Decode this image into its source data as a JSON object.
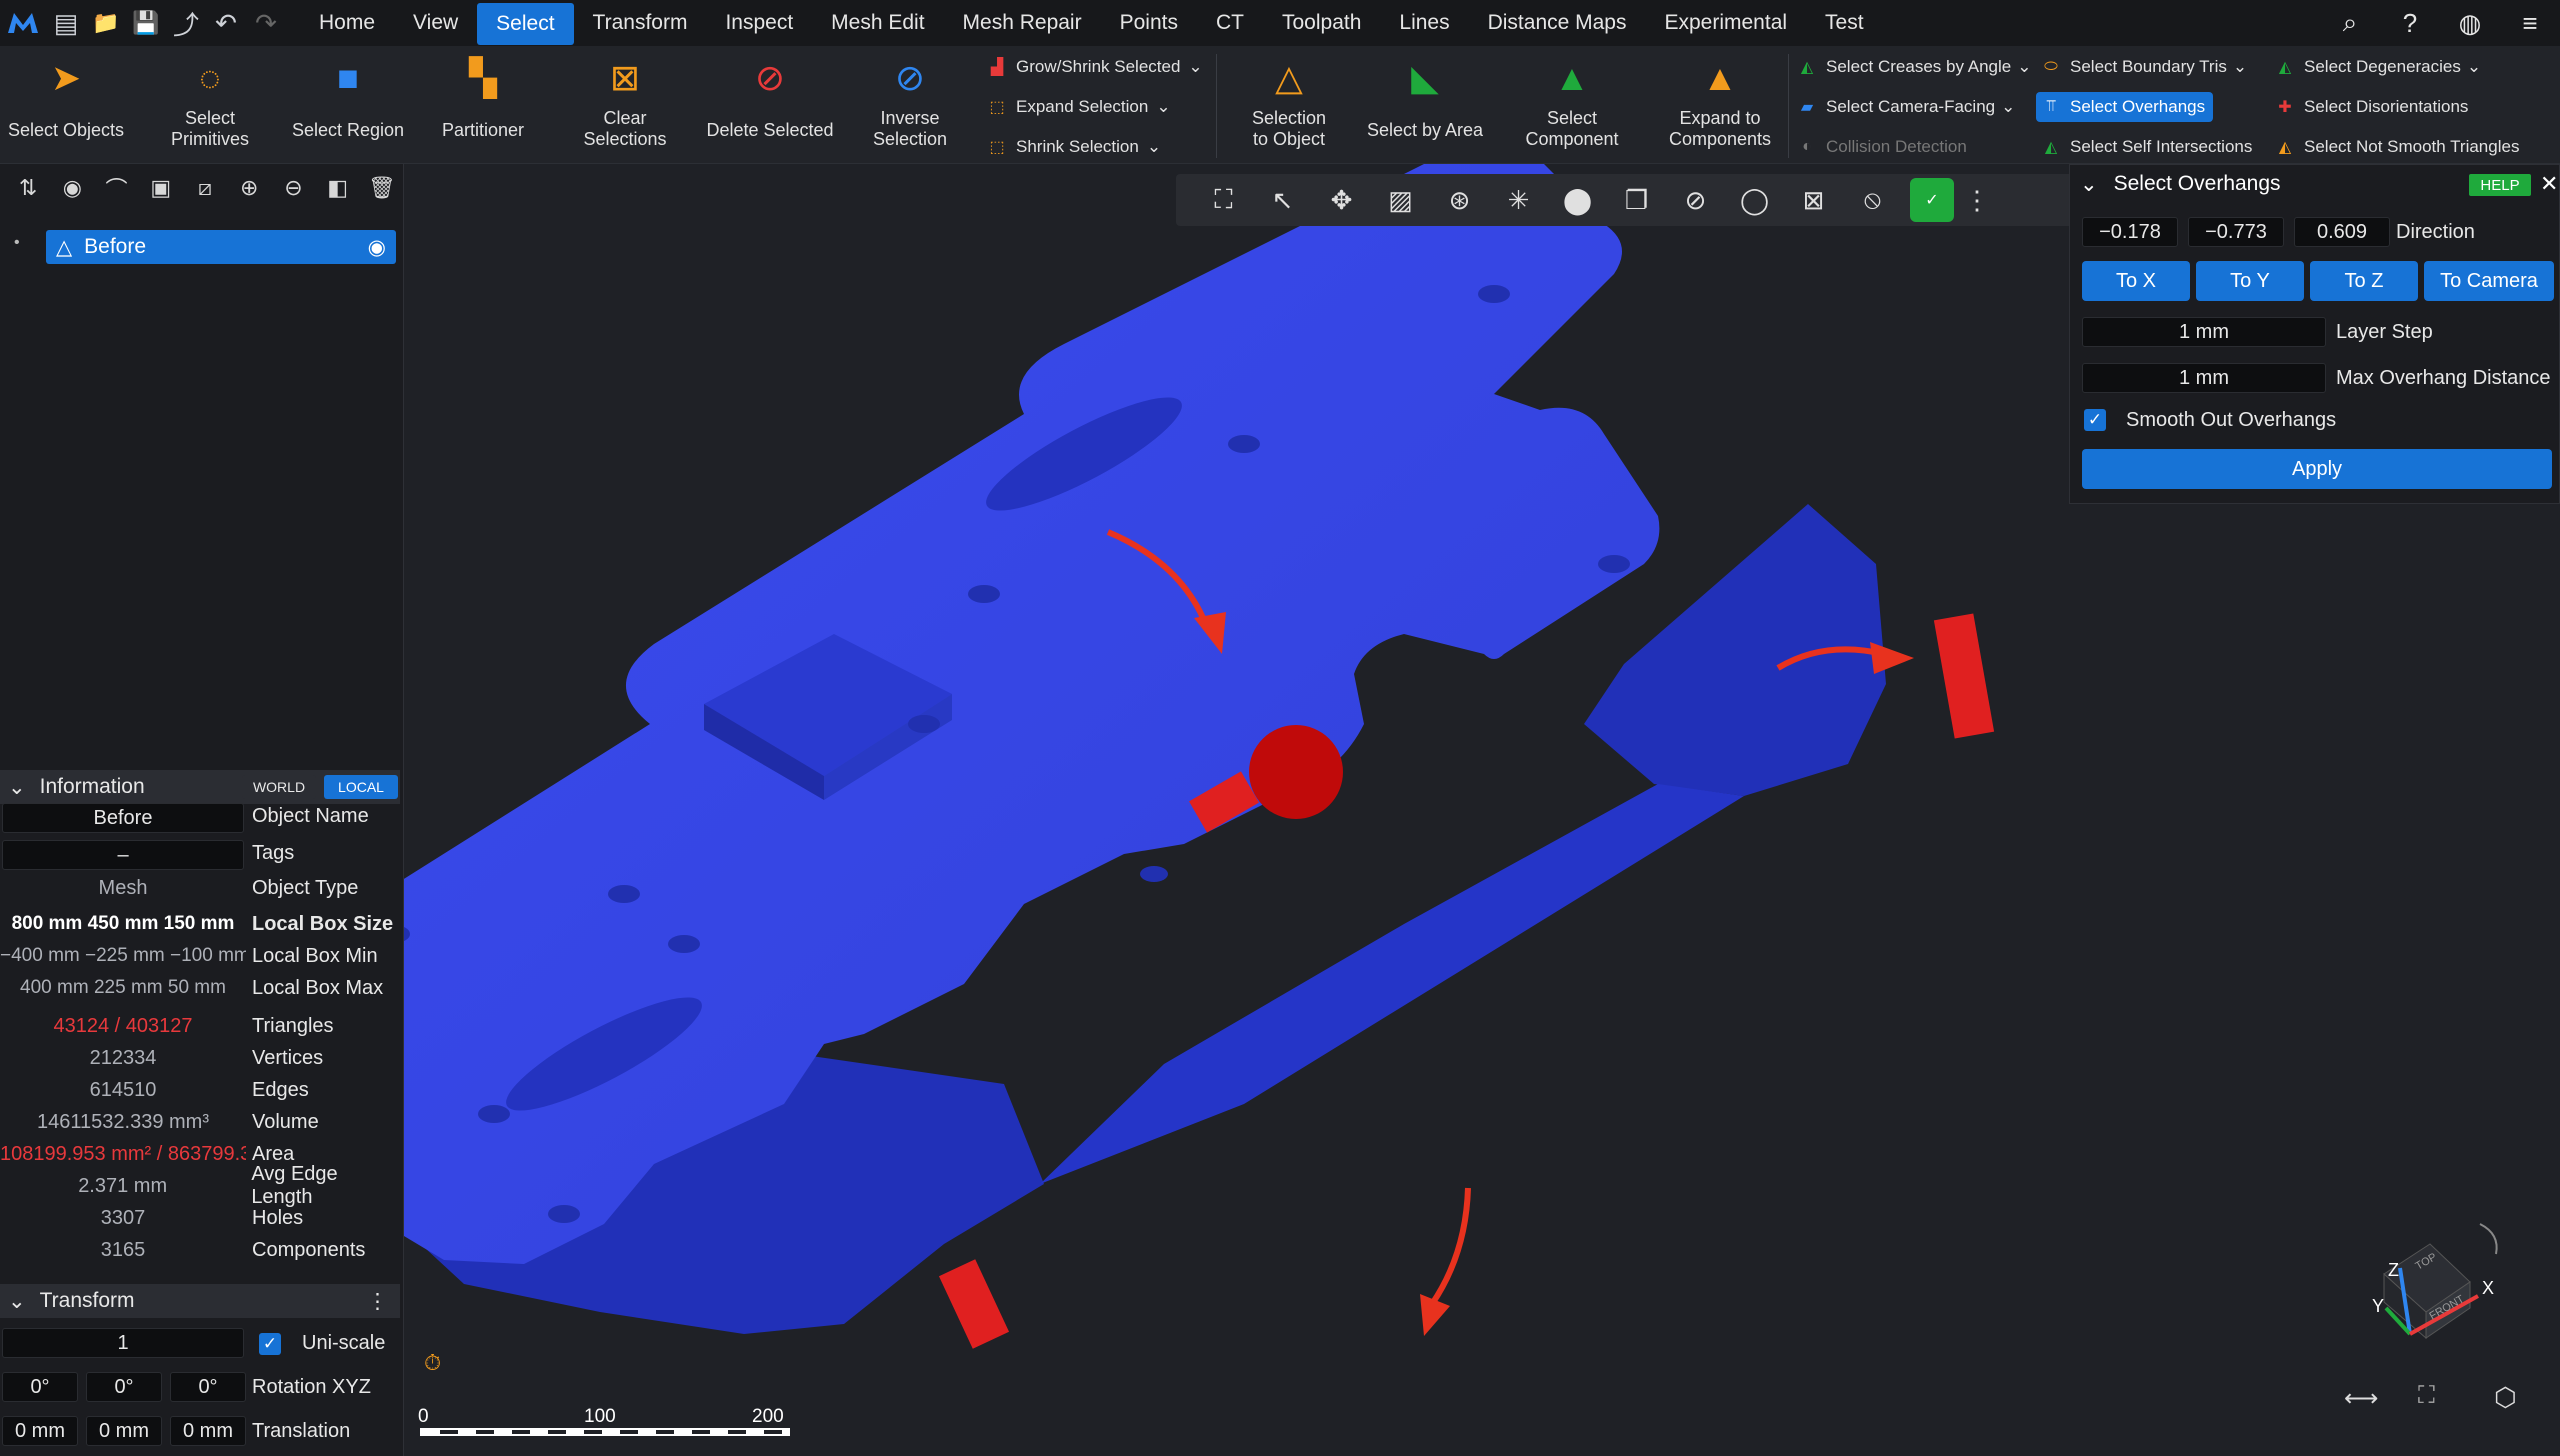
{
  "menubar": {
    "items": [
      "Home",
      "View",
      "Select",
      "Transform",
      "Inspect",
      "Mesh Edit",
      "Mesh Repair",
      "Points",
      "CT",
      "Toolpath",
      "Lines",
      "Distance Maps",
      "Experimental",
      "Test"
    ],
    "active": "Select",
    "right_icons": [
      "search-icon",
      "help-icon",
      "globe-icon",
      "menu-icon"
    ]
  },
  "ribbon": {
    "buttons": [
      {
        "label": "Select Objects",
        "icon": "cursor-icon"
      },
      {
        "label": "Select\nPrimitives",
        "icon": "lasso-icon"
      },
      {
        "label": "Select Region",
        "icon": "cube-icon"
      },
      {
        "label": "Partitioner",
        "icon": "partition-icon"
      },
      {
        "label": "Clear\nSelections",
        "icon": "clear-icon"
      },
      {
        "label": "Delete Selected",
        "icon": "delete-icon"
      },
      {
        "label": "Inverse\nSelection",
        "icon": "inverse-icon"
      },
      {
        "label": "Selection\nto Object",
        "icon": "selection-object-icon"
      },
      {
        "label": "Select by Area",
        "icon": "area-icon"
      },
      {
        "label": "Select\nComponent",
        "icon": "component-icon"
      },
      {
        "label": "Expand to\nComponents",
        "icon": "expand-components-icon"
      }
    ],
    "col1": [
      "Grow/Shrink Selected",
      "Expand Selection",
      "Shrink Selection"
    ],
    "col2": [
      "Select Creases by Angle",
      "Select Camera-Facing",
      "Collision Detection"
    ],
    "col3": [
      "Select Boundary Tris",
      "Select Overhangs",
      "Select Self Intersections"
    ],
    "col4": [
      "Select Degeneracies",
      "Select Disorientations",
      "Select Not Smooth Triangles"
    ]
  },
  "scene": {
    "tree_item": "Before"
  },
  "info": {
    "title": "Information",
    "world": "WORLD",
    "local": "LOCAL",
    "rows": [
      {
        "val": "Before",
        "lab": "Object Name"
      },
      {
        "val": "–",
        "lab": "Tags"
      },
      {
        "val": "Mesh",
        "lab": "Object Type"
      },
      {
        "val": "800 mm   450 mm   150 mm",
        "lab": "Local Box Size"
      },
      {
        "val": "−400 mm   −225 mm   −100 mm",
        "lab": "Local Box Min"
      },
      {
        "val": "400 mm   225 mm   50 mm",
        "lab": "Local Box Max"
      },
      {
        "val": "43124 / 403127",
        "lab": "Triangles",
        "red": true
      },
      {
        "val": "212334",
        "lab": "Vertices"
      },
      {
        "val": "614510",
        "lab": "Edges"
      },
      {
        "val": "14611532.339 mm³",
        "lab": "Volume"
      },
      {
        "val": "108199.953 mm² / 863799.3",
        "lab": "Area",
        "red": true
      },
      {
        "val": "2.371 mm",
        "lab": "Avg Edge Length"
      },
      {
        "val": "3307",
        "lab": "Holes"
      },
      {
        "val": "3165",
        "lab": "Components"
      }
    ]
  },
  "transform": {
    "title": "Transform",
    "scale": "1",
    "uniscale": "Uni-scale",
    "rot": [
      "0°",
      "0°",
      "0°"
    ],
    "rot_label": "Rotation XYZ",
    "trans": [
      "0 mm",
      "0 mm",
      "0 mm"
    ],
    "trans_label": "Translation"
  },
  "overhangs": {
    "title": "Select Overhangs",
    "help": "HELP",
    "dir": [
      "−0.178",
      "−0.773",
      "0.609"
    ],
    "dir_label": "Direction",
    "buttons": [
      "To X",
      "To Y",
      "To Z",
      "To Camera"
    ],
    "layer_step": "1 mm",
    "layer_step_label": "Layer Step",
    "max_dist": "1 mm",
    "max_dist_label": "Max Overhang Distance",
    "smooth_label": "Smooth Out Overhangs",
    "apply": "Apply"
  },
  "scale_bar": {
    "ticks": [
      "0",
      "100",
      "200"
    ]
  },
  "gizmo": {
    "z": "Z",
    "y": "Y",
    "x": "X",
    "top": "TOP",
    "front": "FRONT"
  },
  "colors": {
    "accent": "#1773d6",
    "mesh": "#3a49e6",
    "selected": "#e02020",
    "green": "#1faa3c"
  }
}
